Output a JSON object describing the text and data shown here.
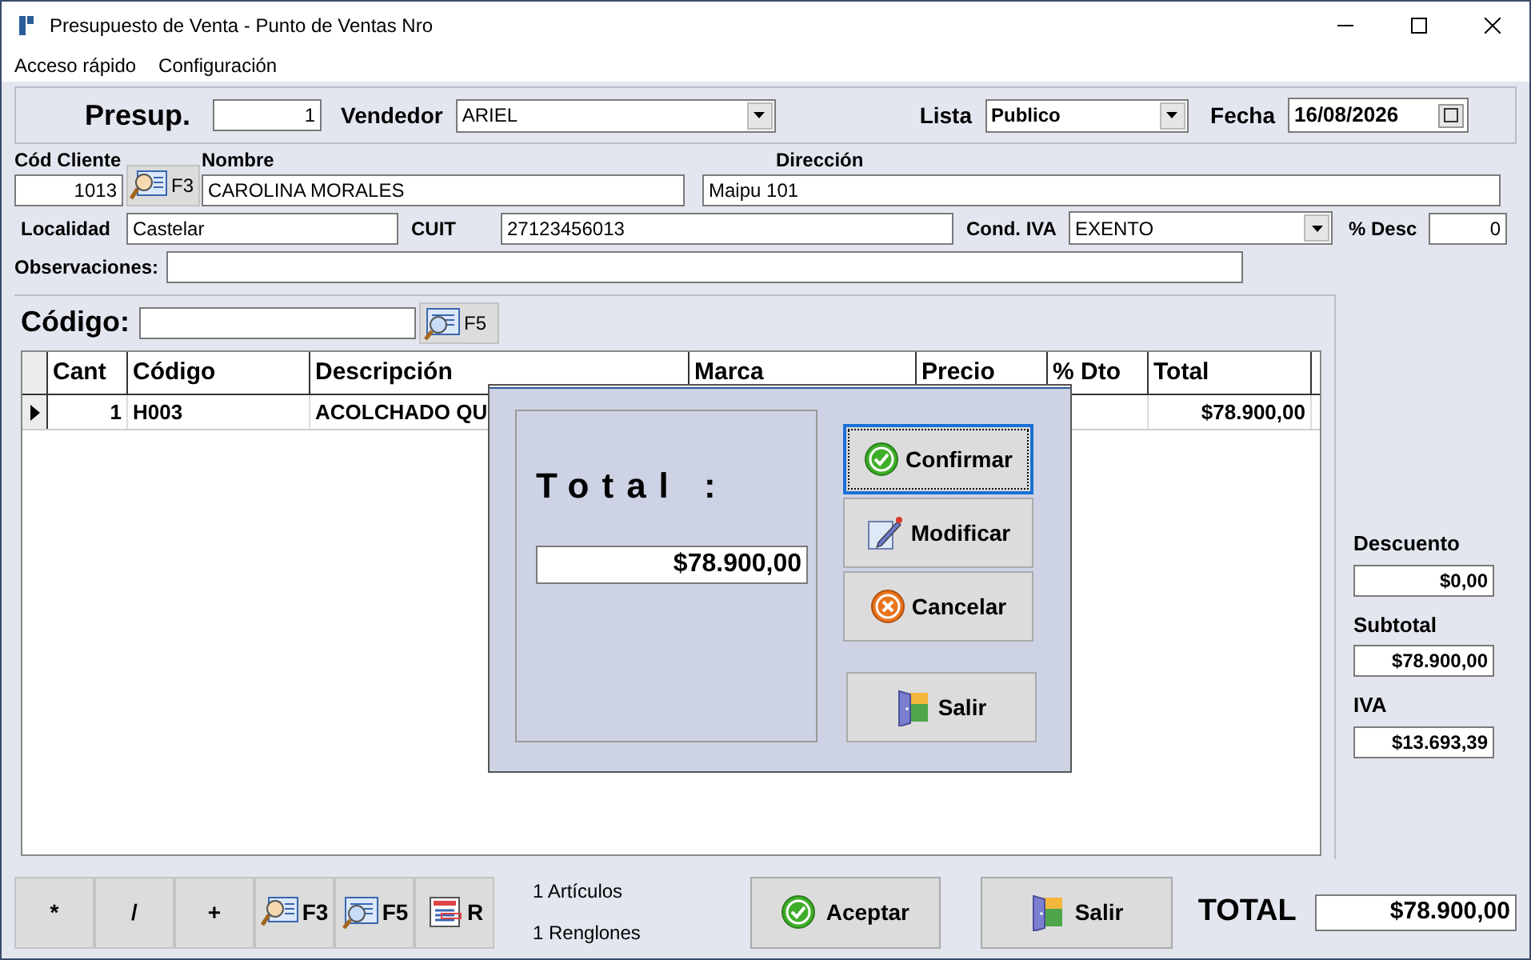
{
  "window": {
    "title": "Presupuesto de Venta -  Punto de Ventas Nro"
  },
  "menu": [
    "Acceso rápido",
    "Configuración"
  ],
  "header": {
    "presup_label": "Presup.",
    "presup_value": "1",
    "vendedor_label": "Vendedor",
    "vendedor_value": "ARIEL",
    "lista_label": "Lista",
    "lista_value": "Publico",
    "fecha_label": "Fecha",
    "fecha_value": "16/08/2026"
  },
  "client": {
    "cod_label": "Cód Cliente",
    "cod_value": "1013",
    "lookup_key": "F3",
    "nombre_label": "Nombre",
    "nombre_value": "CAROLINA MORALES",
    "direccion_label": "Dirección",
    "direccion_value": "Maipu 101",
    "localidad_label": "Localidad",
    "localidad_value": "Castelar",
    "cuit_label": "CUIT",
    "cuit_value": "27123456013",
    "iva_label": "Cond. IVA",
    "iva_value": "EXENTO",
    "desc_label": "% Desc",
    "desc_value": "0",
    "obs_label": "Observaciones:"
  },
  "code_search": {
    "label": "Código:",
    "key": "F5"
  },
  "table": {
    "columns": [
      "Cant",
      "Código",
      "Descripción",
      "Marca",
      "Precio",
      "% Dto",
      "Total"
    ],
    "rows": [
      {
        "current": true,
        "cells": [
          "1",
          "H003",
          "ACOLCHADO QU",
          null,
          null,
          null,
          "$78.900,00"
        ]
      }
    ]
  },
  "side_totals": [
    {
      "label": "Descuento",
      "value": "$0,00"
    },
    {
      "label": "Subtotal",
      "value": "$78.900,00"
    },
    {
      "label": "IVA",
      "value": "$13.693,39"
    }
  ],
  "toolbar": [
    {
      "kind": "text",
      "label": "*"
    },
    {
      "kind": "text",
      "label": "/"
    },
    {
      "kind": "text",
      "label": "+"
    },
    {
      "kind": "client",
      "label": "F3"
    },
    {
      "kind": "search",
      "label": "F5"
    },
    {
      "kind": "list",
      "label": "R"
    }
  ],
  "counts": [
    "1 Artículos",
    "1 Renglones"
  ],
  "actions": [
    {
      "kind": "ok",
      "label": "Aceptar"
    },
    {
      "kind": "exit",
      "label": "Salir"
    }
  ],
  "total": {
    "label": "TOTAL",
    "value": "$78.900,00"
  },
  "dialog": {
    "total_label": "Total :",
    "total_value": "$78.900,00",
    "buttons": [
      {
        "kind": "ok",
        "label": "Confirmar",
        "focused": true
      },
      {
        "kind": "edit",
        "label": "Modificar",
        "focused": false
      },
      {
        "kind": "cancel",
        "label": "Cancelar",
        "focused": false
      },
      {
        "kind": "exit",
        "label": "Salir",
        "focused": false
      }
    ]
  }
}
